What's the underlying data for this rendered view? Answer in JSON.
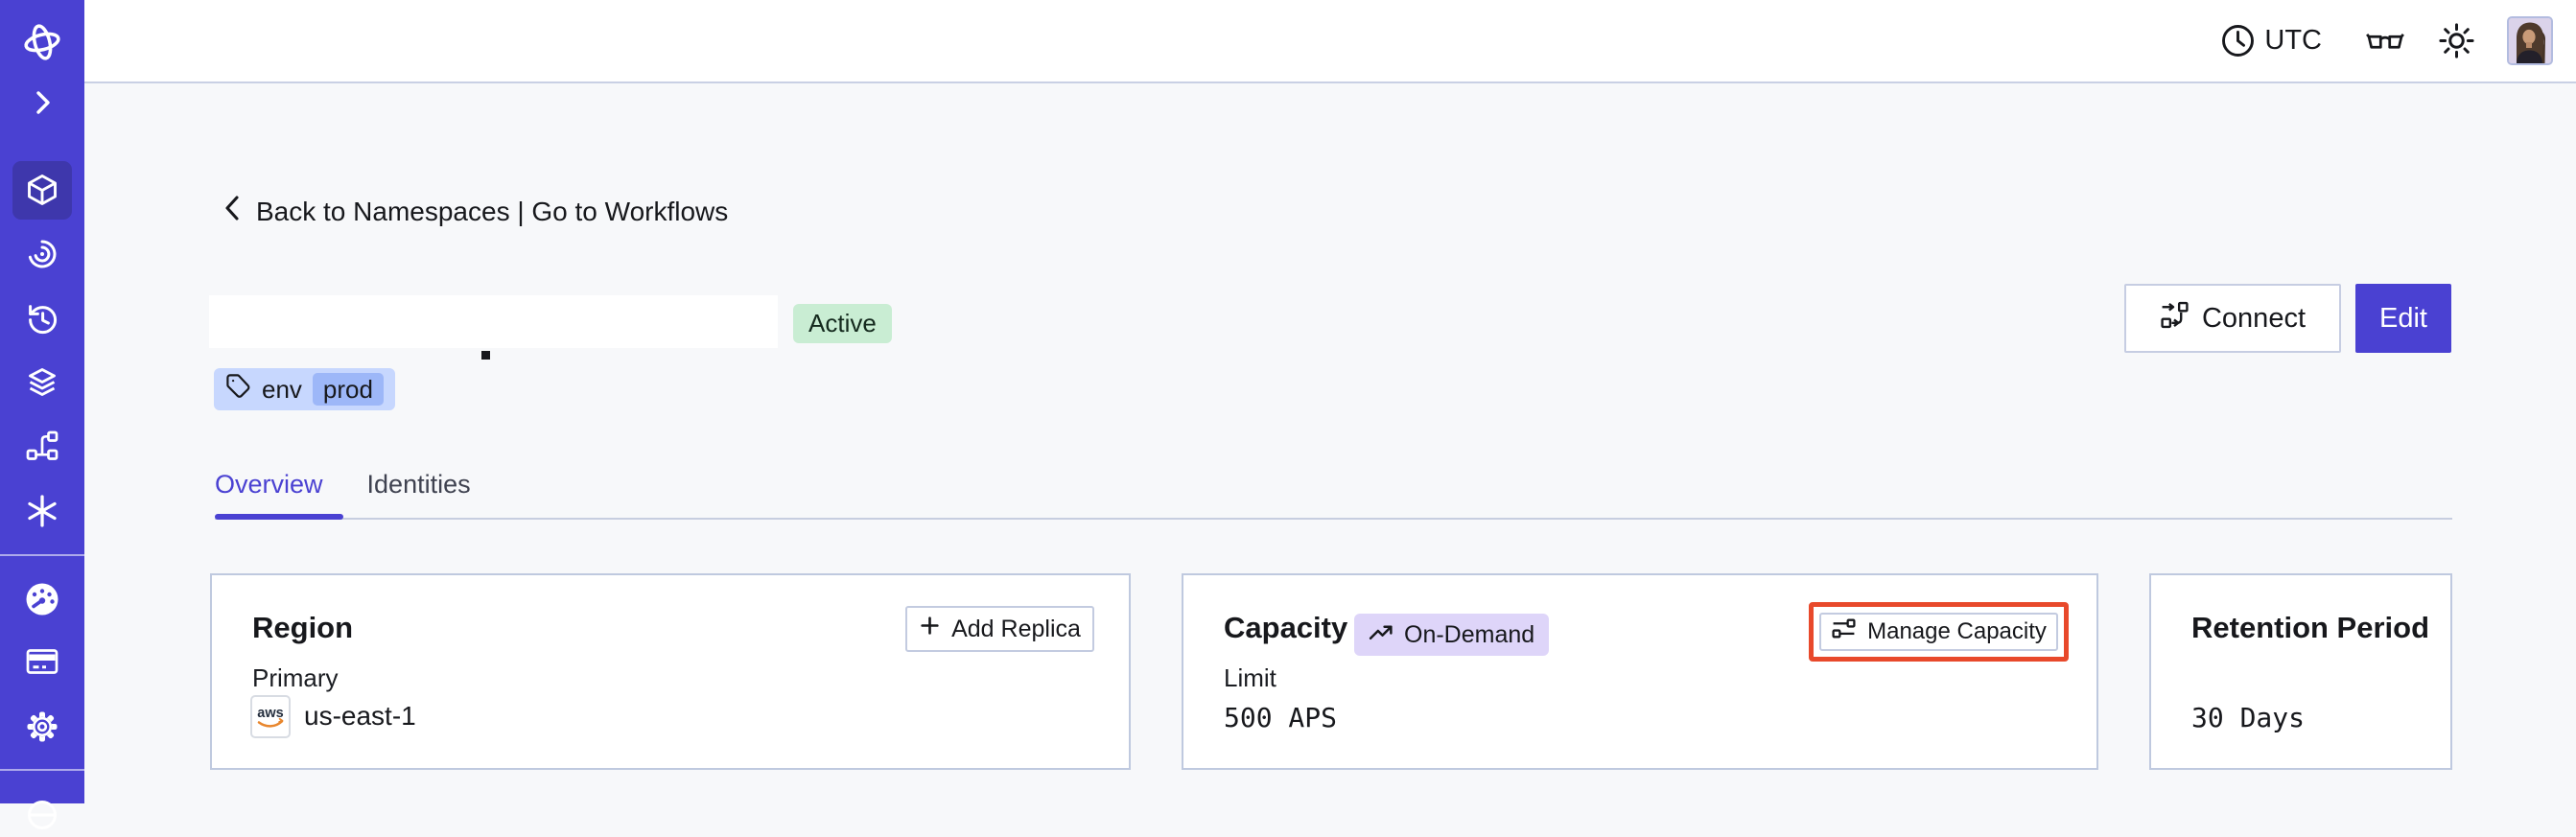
{
  "colors": {
    "accent": "#4A41D2",
    "sidebar_bg": "#4A41D2",
    "sidebar_active_bg": "#3E37AC",
    "page_bg": "#F7F8FA",
    "card_border": "#BFC9DF",
    "active_badge_bg": "#C9EDD3",
    "tag_bg": "#C7D7FE",
    "tag_inner_bg": "#9DB7F8",
    "ondemand_badge_bg": "#DED5F9",
    "highlight_red": "#E8492B"
  },
  "topbar": {
    "timezone": "UTC"
  },
  "breadcrumb": {
    "label": "Back to Namespaces | Go to Workflows"
  },
  "namespace": {
    "status": "Active",
    "tag_key": "env",
    "tag_value": "prod",
    "actions": {
      "connect": "Connect",
      "edit": "Edit"
    }
  },
  "tabs": [
    {
      "label": "Overview",
      "active": true
    },
    {
      "label": "Identities",
      "active": false
    }
  ],
  "cards": {
    "region": {
      "title": "Region",
      "add_replica": "Add Replica",
      "primary_label": "Primary",
      "provider": "aws",
      "value": "us-east-1"
    },
    "capacity": {
      "title": "Capacity",
      "badge": "On-Demand",
      "limit_label": "Limit",
      "limit_value": "500 APS",
      "manage_button": "Manage Capacity"
    },
    "retention": {
      "title": "Retention Period",
      "value": "30 Days"
    }
  },
  "icons": {
    "sidebar": [
      "temporal-logo-icon",
      "chevron-right-icon",
      "cube-icon",
      "eye-swirl-icon",
      "history-icon",
      "layers-icon",
      "fork-icon",
      "asterisk-icon",
      "gauge-icon",
      "credit-card-icon",
      "gear-icon",
      "globe-icon"
    ],
    "topbar": [
      "clock-icon",
      "glasses-icon",
      "sun-icon",
      "avatar"
    ],
    "content": [
      "back-icon",
      "tag-icon",
      "plus-icon",
      "trend-up-icon",
      "sliders-icon",
      "connect-flow-icon",
      "aws-logo"
    ]
  }
}
